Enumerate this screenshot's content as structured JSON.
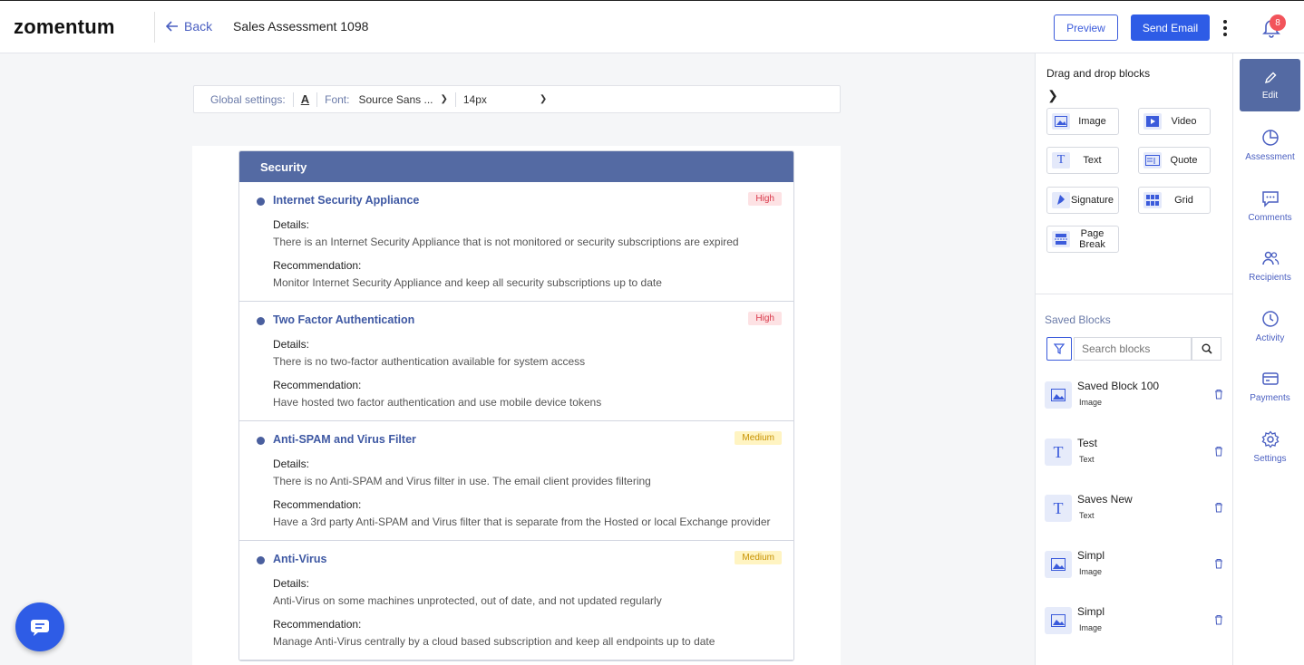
{
  "app": {
    "logo": "zomentum",
    "back_label": "Back",
    "document_title": "Sales Assessment 1098",
    "preview_label": "Preview",
    "send_email_label": "Send Email",
    "notification_count": "8"
  },
  "global_settings": {
    "label": "Global settings:",
    "font_label": "Font:",
    "font_value": "Source Sans ...",
    "size_value": "14px"
  },
  "section": {
    "title": "Security",
    "details_label": "Details:",
    "recommendation_label": "Recommendation:",
    "items": [
      {
        "title": "Internet Security Appliance",
        "severity": "High",
        "details": "There is an Internet Security Appliance that is not monitored or security subscriptions are expired",
        "recommendation": "Monitor Internet Security Appliance and keep all security subscriptions up to date"
      },
      {
        "title": "Two Factor Authentication",
        "severity": "High",
        "details": "There is no two-factor authentication available for system access",
        "recommendation": "Have hosted two factor authentication and use mobile device tokens"
      },
      {
        "title": "Anti-SPAM and Virus Filter",
        "severity": "Medium",
        "details": "There is no Anti-SPAM and Virus filter in use. The email client provides filtering",
        "recommendation": "Have a 3rd party Anti-SPAM and Virus filter that is separate from the Hosted or local Exchange provider"
      },
      {
        "title": "Anti-Virus",
        "severity": "Medium",
        "details": "Anti-Virus on some machines unprotected, out of date, and not updated regularly",
        "recommendation": "Manage Anti-Virus centrally by a cloud based subscription and keep all endpoints up to date"
      }
    ]
  },
  "blocks_panel": {
    "title": "Drag and drop blocks",
    "blocks": [
      "Image",
      "Video",
      "Text",
      "Quote",
      "Signature",
      "Grid",
      "Page Break"
    ],
    "saved_title": "Saved Blocks",
    "search_placeholder": "Search blocks",
    "saved_items": [
      {
        "name": "Saved Block 100",
        "type": "Image"
      },
      {
        "name": "Test",
        "type": "Text"
      },
      {
        "name": "Saves New",
        "type": "Text"
      },
      {
        "name": "Simpl",
        "type": "Image"
      },
      {
        "name": "Simpl",
        "type": "Image"
      }
    ]
  },
  "right_nav": [
    "Edit",
    "Assessment",
    "Comments",
    "Recipients",
    "Activity",
    "Payments",
    "Settings"
  ],
  "colors": {
    "accent": "#2e5ce6",
    "section_header": "#546aa3",
    "high_badge": "#d9394a",
    "medium_badge": "#c79100"
  }
}
